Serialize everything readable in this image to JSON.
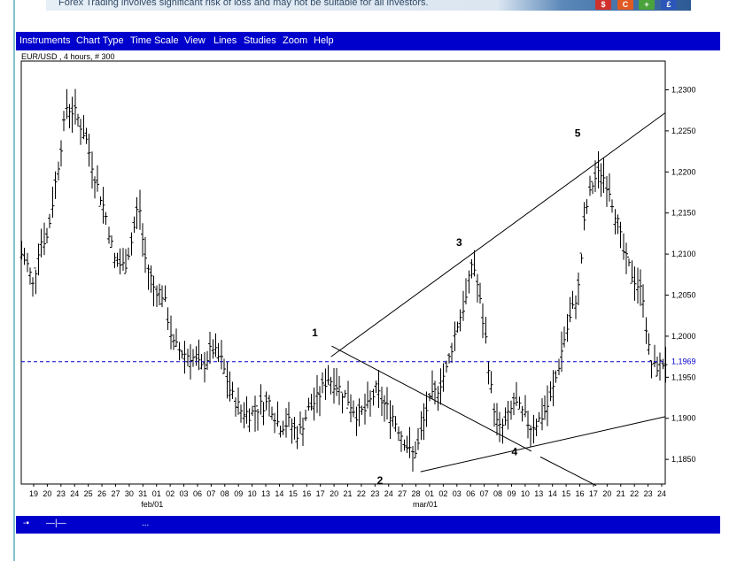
{
  "banner": {
    "text": "Forex Trading involves significant risk of loss and may not be suitable for all investors.",
    "icons": [
      {
        "glyph": "$",
        "color": "#d0312d",
        "name": "dollar-icon"
      },
      {
        "glyph": "C",
        "color": "#e05a22",
        "name": "currency-c-icon"
      },
      {
        "glyph": "+",
        "color": "#4aa33b",
        "name": "plus-icon"
      },
      {
        "glyph": "£",
        "color": "#2c56b8",
        "name": "pound-icon"
      }
    ]
  },
  "menu": {
    "items": [
      "Instruments",
      "Chart Type",
      "Time Scale",
      "View",
      "Lines",
      "Studies",
      "Zoom",
      "Help"
    ]
  },
  "chart_title": "EUR/USD , 4 hours, # 300",
  "status": {
    "items": [
      "-▪",
      "—|—",
      "..."
    ]
  },
  "colors": {
    "menubar": "#0000cc",
    "price_line": "#0000cc",
    "price_label_bg": "#ffffff"
  },
  "chart_data": {
    "type": "bar",
    "title": "EUR/USD , 4 hours, # 300",
    "ylim": [
      1.182,
      1.2335
    ],
    "y_ticks": [
      "1,1850",
      "1,1900",
      "1,1950",
      "1,2000",
      "1,2050",
      "1,2100",
      "1,2150",
      "1,2200",
      "1,2250",
      "1,2300"
    ],
    "y_tick_values": [
      1.185,
      1.19,
      1.195,
      1.2,
      1.205,
      1.21,
      1.215,
      1.22,
      1.225,
      1.23
    ],
    "current_price": 1.1969,
    "current_price_label": "1,1969",
    "x_ticks": [
      "19",
      "20",
      "23",
      "24",
      "25",
      "26",
      "27",
      "30",
      "31",
      "01",
      "02",
      "03",
      "06",
      "07",
      "08",
      "09",
      "10",
      "13",
      "14",
      "15",
      "16",
      "17",
      "20",
      "21",
      "22",
      "23",
      "24",
      "27",
      "28",
      "01",
      "02",
      "03",
      "06",
      "07",
      "08",
      "09",
      "10",
      "13",
      "14",
      "15",
      "16",
      "17",
      "20",
      "21",
      "22",
      "23",
      "24"
    ],
    "x_month_labels": [
      {
        "label": "feb/01",
        "after_index": 9
      },
      {
        "label": "mar/01",
        "after_index": 29
      }
    ],
    "wave_labels": [
      {
        "label": "1",
        "t": 0.456,
        "y": 1.2
      },
      {
        "label": "2",
        "t": 0.557,
        "y": 1.182
      },
      {
        "label": "3",
        "t": 0.68,
        "y": 1.211
      },
      {
        "label": "4",
        "t": 0.766,
        "y": 1.1855
      },
      {
        "label": "5",
        "t": 0.864,
        "y": 1.2243
      }
    ],
    "trendlines": [
      {
        "from": [
          0.481,
          1.1975
        ],
        "to": [
          1.0,
          1.2272
        ]
      },
      {
        "from": [
          0.62,
          1.1835
        ],
        "to": [
          1.0,
          1.1902
        ]
      },
      {
        "from": [
          0.482,
          1.1988
        ],
        "to": [
          0.792,
          1.186
        ]
      },
      {
        "from": [
          0.806,
          1.1853
        ],
        "to": [
          0.893,
          1.1818
        ]
      }
    ],
    "path": [
      [
        0.0,
        1.21
      ],
      [
        0.01,
        1.2085
      ],
      [
        0.018,
        1.206
      ],
      [
        0.028,
        1.2115
      ],
      [
        0.04,
        1.212
      ],
      [
        0.055,
        1.22
      ],
      [
        0.07,
        1.228
      ],
      [
        0.085,
        1.227
      ],
      [
        0.1,
        1.224
      ],
      [
        0.115,
        1.219
      ],
      [
        0.13,
        1.215
      ],
      [
        0.145,
        1.209
      ],
      [
        0.16,
        1.2085
      ],
      [
        0.172,
        1.212
      ],
      [
        0.182,
        1.2165
      ],
      [
        0.19,
        1.21
      ],
      [
        0.205,
        1.206
      ],
      [
        0.22,
        1.205
      ],
      [
        0.235,
        1.199
      ],
      [
        0.25,
        1.198
      ],
      [
        0.265,
        1.1975
      ],
      [
        0.28,
        1.196
      ],
      [
        0.295,
        1.1985
      ],
      [
        0.31,
        1.197
      ],
      [
        0.325,
        1.193
      ],
      [
        0.34,
        1.191
      ],
      [
        0.355,
        1.1905
      ],
      [
        0.37,
        1.1915
      ],
      [
        0.385,
        1.192
      ],
      [
        0.4,
        1.189
      ],
      [
        0.415,
        1.1895
      ],
      [
        0.43,
        1.188
      ],
      [
        0.445,
        1.191
      ],
      [
        0.46,
        1.1925
      ],
      [
        0.475,
        1.195
      ],
      [
        0.49,
        1.194
      ],
      [
        0.505,
        1.1925
      ],
      [
        0.52,
        1.1905
      ],
      [
        0.535,
        1.191
      ],
      [
        0.55,
        1.1935
      ],
      [
        0.56,
        1.192
      ],
      [
        0.575,
        1.1905
      ],
      [
        0.59,
        1.188
      ],
      [
        0.605,
        1.1855
      ],
      [
        0.615,
        1.1865
      ],
      [
        0.63,
        1.1915
      ],
      [
        0.645,
        1.1935
      ],
      [
        0.66,
        1.196
      ],
      [
        0.675,
        1.201
      ],
      [
        0.69,
        1.2045
      ],
      [
        0.7,
        1.2095
      ],
      [
        0.708,
        1.206
      ],
      [
        0.72,
        1.2
      ],
      [
        0.73,
        1.193
      ],
      [
        0.74,
        1.1885
      ],
      [
        0.752,
        1.1895
      ],
      [
        0.765,
        1.192
      ],
      [
        0.778,
        1.1905
      ],
      [
        0.79,
        1.189
      ],
      [
        0.8,
        1.1895
      ],
      [
        0.81,
        1.1905
      ],
      [
        0.82,
        1.192
      ],
      [
        0.83,
        1.195
      ],
      [
        0.842,
        1.1995
      ],
      [
        0.855,
        1.203
      ],
      [
        0.865,
        1.206
      ],
      [
        0.875,
        1.215
      ],
      [
        0.888,
        1.219
      ],
      [
        0.9,
        1.22
      ],
      [
        0.912,
        1.218
      ],
      [
        0.925,
        1.214
      ],
      [
        0.935,
        1.21
      ],
      [
        0.948,
        1.2075
      ],
      [
        0.958,
        1.206
      ],
      [
        0.965,
        1.205
      ],
      [
        0.972,
        1.199
      ],
      [
        0.98,
        1.196
      ],
      [
        0.99,
        1.1965
      ],
      [
        1.0,
        1.1969
      ]
    ]
  }
}
